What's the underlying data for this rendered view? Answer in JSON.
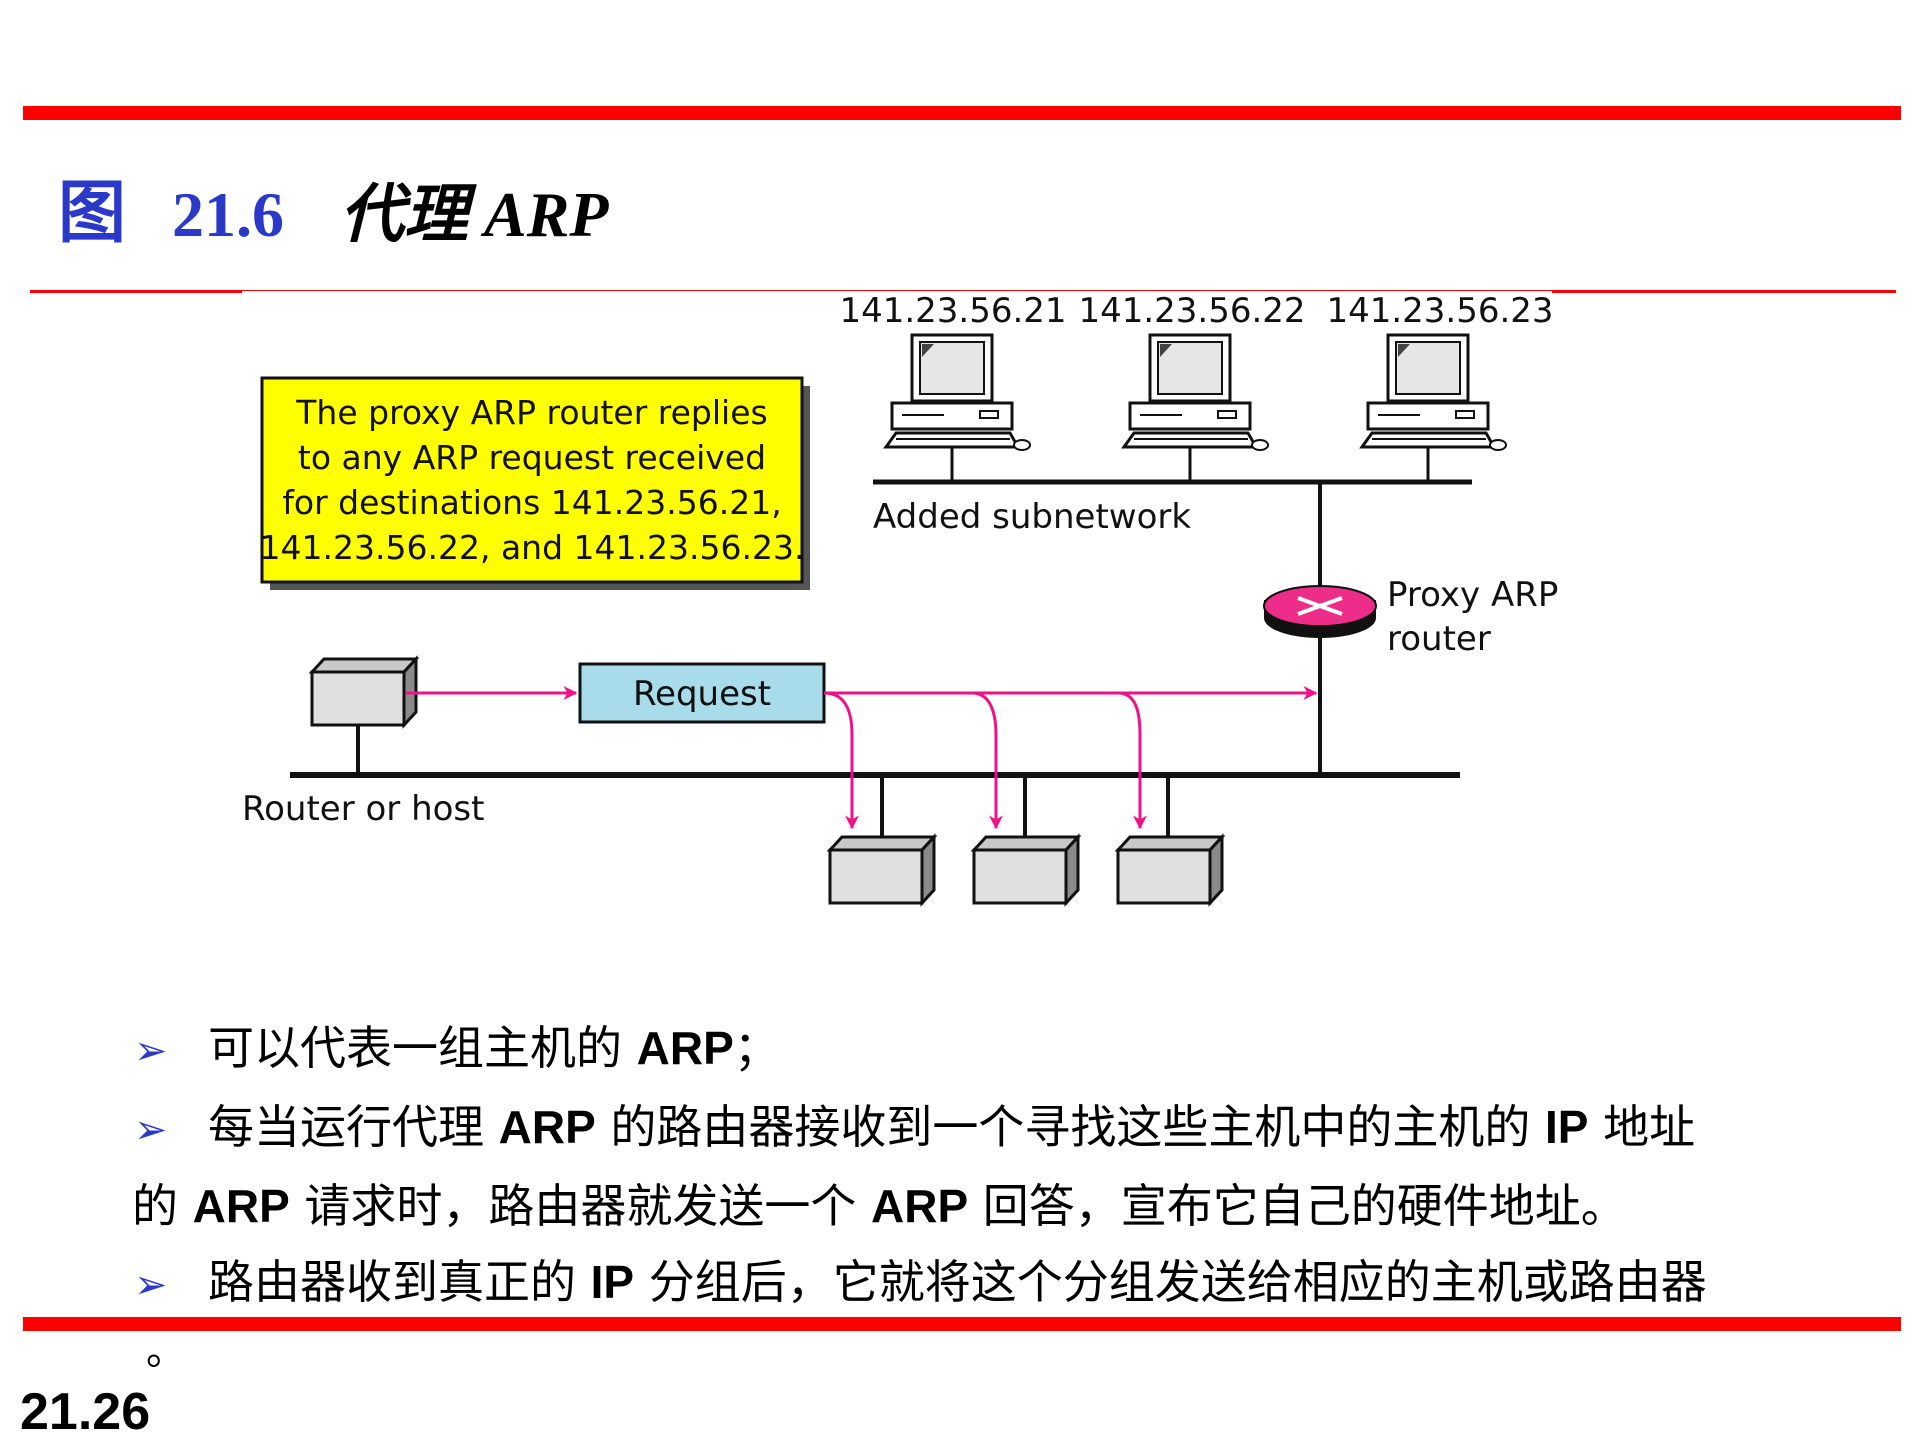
{
  "slide": {
    "title_fig": "图",
    "title_number": "21.6",
    "title_text": "代理 ARP",
    "page_number": "21.26"
  },
  "colors": {
    "rule": "#ff0000",
    "title_blue": "#2b39c9",
    "note_fill": "#ffff00",
    "request_fill": "#a9dcea",
    "arrow": "#ee1188",
    "router": "#ee2d8a"
  },
  "diagram": {
    "host_ips": [
      "141.23.56.21",
      "141.23.56.22",
      "141.23.56.23"
    ],
    "note_lines": [
      "The proxy ARP router replies",
      "to any ARP request received",
      "for destinations 141.23.56.21,",
      "141.23.56.22, and 141.23.56.23."
    ],
    "subnet_label": "Added subnetwork",
    "router_label_1": "Proxy ARP",
    "router_label_2": "router",
    "request_label": "Request",
    "source_label": "Router or host",
    "icons": [
      "computer-icon",
      "router-icon",
      "host-box-icon"
    ]
  },
  "bullets": {
    "b1_a": "可以代表一组主机的 ",
    "b1_b": "ARP",
    "b1_c": "；",
    "b2_a": "每当运行代理 ",
    "b2_b": "ARP",
    "b2_c": " 的路由器接收到一个寻找这些主机中的主机的 ",
    "b2_d": "IP",
    "b2_e": " 地址",
    "b2_f": "的 ",
    "b2_g": "ARP",
    "b2_h": " 请求时，路由器就发送一个 ",
    "b2_i": "ARP",
    "b2_j": " 回答，宣布它自己的硬件地址。",
    "b3_a": "路由器收到真正的 ",
    "b3_b": "IP",
    "b3_c": " 分组后，它就将这个分组发送给相应的主机或路由器",
    "b3_trail": "。"
  }
}
